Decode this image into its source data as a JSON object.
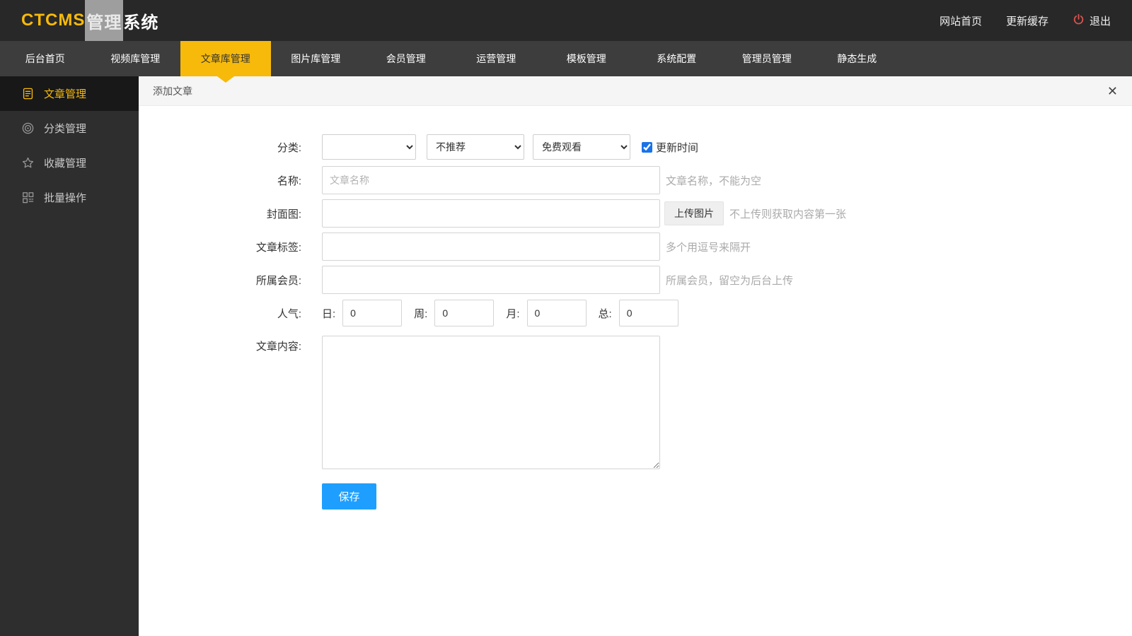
{
  "colors": {
    "accent_yellow": "#f7ba0b",
    "topbar_bg": "#282828",
    "navbar_bg": "#3d3d3d",
    "sidebar_bg": "#2e2e2e",
    "save_blue": "#1e9fff",
    "logout_red": "#d9534f",
    "checkbox_blue": "#1a73e8"
  },
  "topbar": {
    "logo": {
      "ctcms": "CTCMS",
      "guanli": "管理",
      "xitong": "系统"
    },
    "home_link": "网站首页",
    "cache_link": "更新缓存",
    "logout_link": "退出"
  },
  "navbar": {
    "tabs": [
      {
        "label": "后台首页",
        "active": false
      },
      {
        "label": "视频库管理",
        "active": false
      },
      {
        "label": "文章库管理",
        "active": true
      },
      {
        "label": "图片库管理",
        "active": false
      },
      {
        "label": "会员管理",
        "active": false
      },
      {
        "label": "运营管理",
        "active": false
      },
      {
        "label": "模板管理",
        "active": false
      },
      {
        "label": "系统配置",
        "active": false
      },
      {
        "label": "管理员管理",
        "active": false
      },
      {
        "label": "静态生成",
        "active": false
      }
    ]
  },
  "sidebar": {
    "items": [
      {
        "label": "文章管理",
        "icon": "article-icon",
        "active": true
      },
      {
        "label": "分类管理",
        "icon": "category-icon",
        "active": false
      },
      {
        "label": "收藏管理",
        "icon": "star-icon",
        "active": false
      },
      {
        "label": "批量操作",
        "icon": "batch-icon",
        "active": false
      }
    ]
  },
  "content": {
    "tab_title": "添加文章",
    "close_label": "✕",
    "form": {
      "category": {
        "label": "分类:",
        "select1_value": "",
        "select2_value": "不推荐",
        "select3_value": "免费观看",
        "update_time_label": "更新时间",
        "update_time_checked": "checked"
      },
      "name": {
        "label": "名称:",
        "placeholder": "文章名称",
        "hint": "文章名称，不能为空"
      },
      "cover": {
        "label": "封面图:",
        "upload_button": "上传图片",
        "hint": "不上传则获取内容第一张"
      },
      "tags": {
        "label": "文章标签:",
        "hint": "多个用逗号来隔开"
      },
      "member": {
        "label": "所属会员:",
        "hint": "所属会员，留空为后台上传"
      },
      "popularity": {
        "label": "人气:",
        "day_label": "日:",
        "day_value": "0",
        "week_label": "周:",
        "week_value": "0",
        "month_label": "月:",
        "month_value": "0",
        "total_label": "总:",
        "total_value": "0"
      },
      "article_content": {
        "label": "文章内容:"
      },
      "save_button": "保存"
    }
  }
}
